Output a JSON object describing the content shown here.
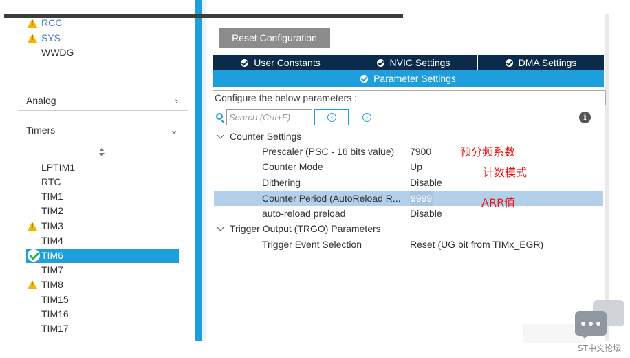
{
  "sidebar": {
    "top_items": [
      {
        "label": "RCC",
        "status": "warning"
      },
      {
        "label": "SYS",
        "status": "warning"
      },
      {
        "label": "WWDG",
        "status": "none"
      }
    ],
    "categories": {
      "analog": "Analog",
      "timers": "Timers"
    },
    "timer_items": [
      {
        "label": "LPTIM1",
        "status": "none"
      },
      {
        "label": "RTC",
        "status": "none"
      },
      {
        "label": "TIM1",
        "status": "none"
      },
      {
        "label": "TIM2",
        "status": "none"
      },
      {
        "label": "TIM3",
        "status": "warning"
      },
      {
        "label": "TIM4",
        "status": "none"
      },
      {
        "label": "TIM6",
        "status": "selected"
      },
      {
        "label": "TIM7",
        "status": "none"
      },
      {
        "label": "TIM8",
        "status": "warning"
      },
      {
        "label": "TIM15",
        "status": "none"
      },
      {
        "label": "TIM16",
        "status": "none"
      },
      {
        "label": "TIM17",
        "status": "none"
      }
    ]
  },
  "main": {
    "reset_button": "Reset Configuration",
    "tabs_row1": [
      "User Constants",
      "NVIC Settings",
      "DMA Settings"
    ],
    "tabs_row2": [
      "Parameter Settings"
    ],
    "configure_label": "Configure the below parameters :",
    "search": {
      "placeholder": "Search (Crtl+F)",
      "value": ""
    },
    "groups": [
      {
        "title": "Counter Settings",
        "params": [
          {
            "name": "Prescaler (PSC - 16 bits value)",
            "value": "7900",
            "highlighted": false
          },
          {
            "name": "Counter Mode",
            "value": "Up",
            "highlighted": false
          },
          {
            "name": "Dithering",
            "value": "Disable",
            "highlighted": false
          },
          {
            "name": "Counter Period (AutoReload R...",
            "value": "9999",
            "highlighted": true
          },
          {
            "name": "auto-reload preload",
            "value": "Disable",
            "highlighted": false
          }
        ]
      },
      {
        "title": "Trigger Output (TRGO) Parameters",
        "params": [
          {
            "name": "Trigger Event Selection",
            "value": "Reset (UG bit from TIMx_EGR)",
            "highlighted": false
          }
        ]
      }
    ],
    "annotations": [
      "预分频系数",
      "计数模式",
      "ARR值"
    ]
  },
  "watermark": "ST中文论坛",
  "colors": {
    "accent": "#1d9fdb",
    "tab_dark": "#0c2a4a",
    "warning": "#f2b600",
    "annotation": "#ee1111",
    "highlight_row": "#b3cfe9"
  }
}
